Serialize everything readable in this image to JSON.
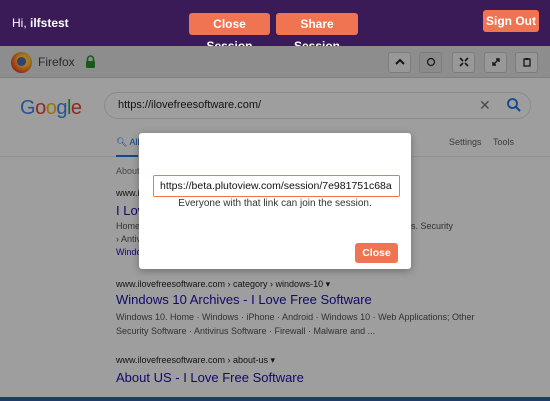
{
  "topbar": {
    "greeting_prefix": "Hi, ",
    "username": "ilfstest",
    "close_session_label": "Close Session",
    "share_session_label": "Share Session",
    "sign_out_label": "Sign Out",
    "accent_color": "#f07452",
    "bar_color": "#3b1b57"
  },
  "browser": {
    "name": "Firefox",
    "controls": [
      "chevron-up-icon",
      "circle-icon",
      "shrink-icon",
      "expand-icon",
      "clipboard-icon"
    ]
  },
  "google": {
    "logo_text": "Google",
    "search_value": "https://ilovefreesoftware.com/",
    "tab_all": "All",
    "tab_settings": "Settings",
    "tab_tools": "Tools",
    "about_text": "About",
    "results": [
      {
        "url": "www.i",
        "title": "I Lov",
        "snippet1": "Home",
        "snippet2": "› Antiv",
        "snippet3": "Windo",
        "snippet_right": "s. Security"
      },
      {
        "url": "www.ilovefreesoftware.com › category › windows-10 ▾",
        "title": "Windows 10 Archives - I Love Free Software",
        "snippet1": "Windows 10. Home · Windows · iPhone · Android · Windows 10 · Web Applications; Other",
        "snippet2": "Security Software · Antivirus Software · Firewall · Malware and ..."
      },
      {
        "url": "www.ilovefreesoftware.com › about-us ▾",
        "title": "About US - I Love Free Software"
      }
    ]
  },
  "modal": {
    "link_value": "https://beta.plutoview.com/session/7e981751c68a",
    "note": "Everyone with that link can join the session.",
    "close_label": "Close"
  }
}
